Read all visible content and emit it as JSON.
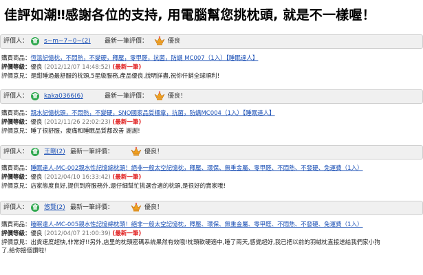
{
  "page_title": "佳評如潮‼感謝各位的支持, 用電腦幫您挑枕頭, 就是不一樣喔！",
  "labels": {
    "reviewer": "評價人：",
    "latest": "最新一筆評價：",
    "purchased": "購買商品：",
    "grade": "評價等級：",
    "opinion": "評價意見：",
    "latest_tag": "(最新一筆)"
  },
  "reviews": [
    {
      "user": "s~m~7~0~(2)",
      "rating_icon": "crown-icon",
      "rating": "優良",
      "product": "恆溫記憶枕，不悶熱，不變硬，釋壓，零甲醛，抗菌，防螨 MC007（1入）【睡眠達人】",
      "grade": "優良",
      "date": "(2012/12/07 14:48:52)",
      "opinion": "是甜睡過最舒服的枕頭,5星級服務,產品優良,說明詳盡,祝你仟銷全球順利!"
    },
    {
      "user": "kaka0366(6)",
      "rating_icon": "crown-icon",
      "rating": "優良！",
      "product": "親水記憶枕頭，不悶熱，不變硬，SNO國家品質標章，抗菌，防螨MC004（1入）【睡眠達人】",
      "grade": "優良",
      "date": "(2012/11/26 22:02:23)",
      "opinion": "睡了很舒服，痠痛和睡眠品質都改善 謝謝!"
    },
    {
      "user": "王剛(2)",
      "rating_icon": "crown-icon",
      "rating": "優良！",
      "product": "睡眠達人-MC-002親水性記憶綿枕頭！絕非一般太空記憶枕，釋壓、環保、無重金屬、零甲醛、不悶熱、不發硬、免運費（1入）",
      "grade": "優良",
      "date": "(2012/04/10 16:33:42)",
      "opinion": "店家態度良好,提供到府服務外,還仔細幫忙挑選合適的枕頭,是很好的賣家哦!"
    },
    {
      "user": "悠覽(2)",
      "rating_icon": "crown-icon",
      "rating": "優良！",
      "product": "睡眠達人-MC-005親水性記憶綿枕頭！絕非一般太空記憶枕，釋壓、環保、無重金屬、零甲醛、不悶熱、不發硬、免運費（1入）",
      "grade": "優良",
      "date": "(2012/04/07 21:00:39)",
      "opinion": "出貨速度超快,非常好!!另外,店里的枕頭密碼系統果然有效哦!枕頭軟硬適中,睡了兩天,感覺超好,我已把以前的羽絨枕直接送給我們家小狗了,給你接個讚啦!"
    }
  ]
}
